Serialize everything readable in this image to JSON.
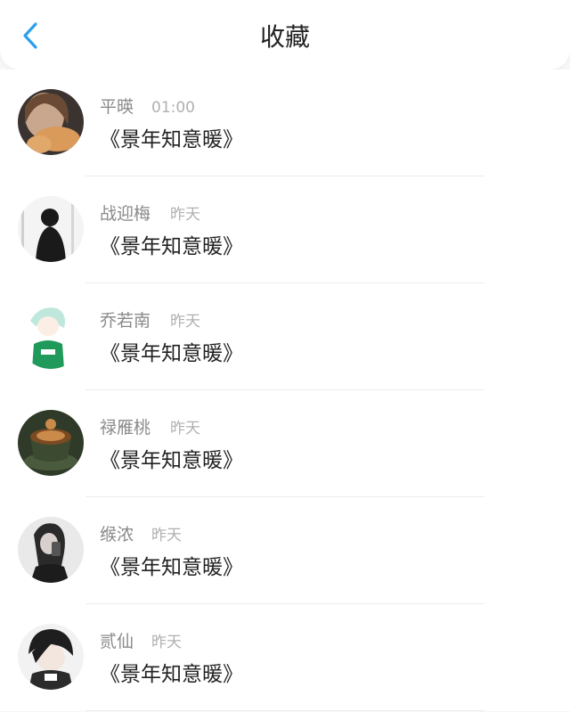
{
  "header": {
    "title": "收藏",
    "back_icon": "chevron-left-icon",
    "accent": "#2b9ef0"
  },
  "items": [
    {
      "name": "平暎",
      "time": "01:00",
      "book": "《景年知意暖》",
      "avatar": "girl-with-cat-avatar"
    },
    {
      "name": "战迎梅",
      "time": "昨天",
      "book": "《景年知意暖》",
      "avatar": "silhouette-avatar"
    },
    {
      "name": "乔若南",
      "time": "昨天",
      "book": "《景年知意暖》",
      "avatar": "anime-green-shirt-avatar"
    },
    {
      "name": "禄雁桃",
      "time": "昨天",
      "book": "《景年知意暖》",
      "avatar": "coffee-cup-avatar"
    },
    {
      "name": "缑浓",
      "time": "昨天",
      "book": "《景年知意暖》",
      "avatar": "girl-selfie-avatar"
    },
    {
      "name": "贰仙",
      "time": "昨天",
      "book": "《景年知意暖》",
      "avatar": "anime-boy-avatar"
    }
  ]
}
